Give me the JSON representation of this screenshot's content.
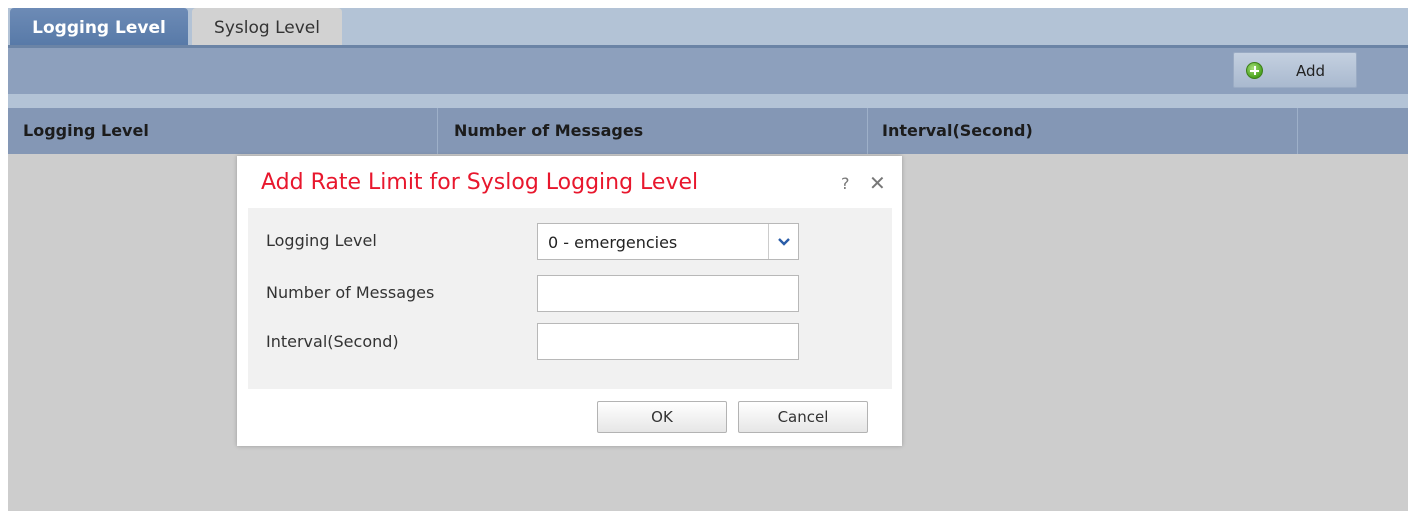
{
  "tabs": [
    {
      "label": "Logging Level",
      "active": true
    },
    {
      "label": "Syslog Level",
      "active": false
    }
  ],
  "toolbar": {
    "add_label": "Add",
    "add_icon": "add-circle-icon"
  },
  "table": {
    "columns": [
      "Logging Level",
      "Number of Messages",
      "Interval(Second)",
      ""
    ]
  },
  "dialog": {
    "title": "Add Rate Limit for Syslog Logging Level",
    "help_glyph": "?",
    "close_glyph": "✕",
    "fields": {
      "logging_level": {
        "label": "Logging Level",
        "value": "0 - emergencies"
      },
      "number_of_messages": {
        "label": "Number of Messages",
        "value": ""
      },
      "interval": {
        "label": "Interval(Second)",
        "value": ""
      }
    },
    "ok_label": "OK",
    "cancel_label": "Cancel"
  },
  "colors": {
    "title": "#e8172d",
    "tab_active": "#587aa8",
    "header": "#8497b5",
    "toolbar": "#8da0bd"
  }
}
